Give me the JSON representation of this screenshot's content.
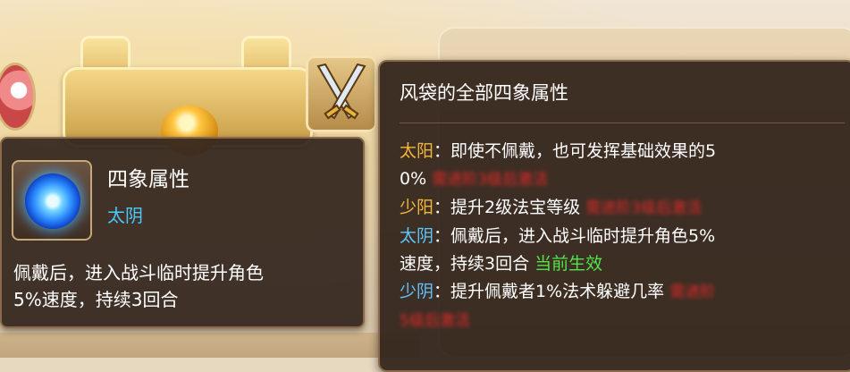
{
  "left_tooltip": {
    "icon": "water-orb-icon",
    "title": "四象属性",
    "subtitle": "太阴",
    "description_line1": "佩戴后，进入战斗临时提升角色",
    "description_line2": "5%速度，持续3回合"
  },
  "right_tooltip": {
    "title": "风袋的全部四象属性",
    "rows": [
      {
        "label": "太阳",
        "colon": "：",
        "text_line1": "即使不佩戴，也可发挥基础效果的5",
        "text_line2": "0%",
        "status": "需进阶3级后激活",
        "status_type": "locked"
      },
      {
        "label": "少阳",
        "colon": "：",
        "text_line1": "提升2级法宝等级",
        "status": "需进阶3级后激活",
        "status_type": "locked"
      },
      {
        "label": "太阴",
        "colon": "：",
        "text_line1": "佩戴后，进入战斗临时提升角色5%",
        "text_line2": "速度，持续3回合",
        "status": "当前生效",
        "status_type": "active"
      },
      {
        "label": "少阴",
        "colon": "：",
        "text_line1": "提升佩戴者1%法术躲避几率",
        "status": "需进阶",
        "status_line2": "5级后激活",
        "status_type": "locked"
      }
    ]
  },
  "colors": {
    "panel_bg": "#32241c",
    "title_text": "#ffffff",
    "yang_label": "#f4b63c",
    "yin_label": "#5ec6ff",
    "active_status": "#52e44a",
    "locked_status": "#e12a2a"
  }
}
